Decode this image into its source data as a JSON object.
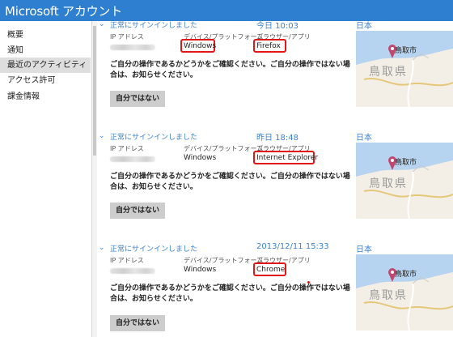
{
  "app": {
    "title": "Microsoft アカウント"
  },
  "sidebar": {
    "items": [
      {
        "label": "概要",
        "active": false
      },
      {
        "label": "通知",
        "active": false
      },
      {
        "label": "最近のアクティビティ",
        "active": true
      },
      {
        "label": "アクセス許可",
        "active": false
      },
      {
        "label": "課金情報",
        "active": false
      }
    ]
  },
  "labels": {
    "ip": "IP アドレス",
    "device": "デバイス/プラットフォーム",
    "browser": "ブラウザー/アプリ",
    "message": "ご自分の操作であるかどうかをご確認ください。ご自分の操作ではない場合は、お知らせください。",
    "not_me_button": "自分ではない"
  },
  "map": {
    "city": "鳥取市",
    "prefecture": "鳥取県"
  },
  "entries": [
    {
      "status": "正常にサインインしました",
      "time": "今日 10:03",
      "country": "日本",
      "device": "Windows",
      "browser": "Firefox"
    },
    {
      "status": "正常にサインインしました",
      "time": "昨日 18:48",
      "country": "日本",
      "device": "Windows",
      "browser": "Internet Explorer"
    },
    {
      "status": "正常にサインインしました",
      "time": "2013/12/11 15:33",
      "country": "日本",
      "device": "Windows",
      "browser": "Chrome"
    }
  ],
  "colors": {
    "titlebar": "#2f7fd1",
    "accent": "#3b83cf",
    "highlight": "#e01717"
  }
}
